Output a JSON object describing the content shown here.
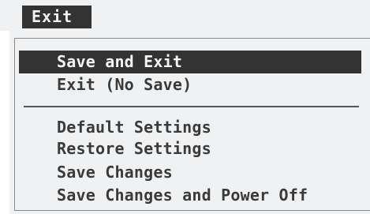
{
  "menu": {
    "title": "Exit"
  },
  "items": {
    "group1": [
      {
        "label": "Save and Exit",
        "selected": true
      },
      {
        "label": "Exit (No Save)",
        "selected": false
      }
    ],
    "group2": [
      {
        "label": "Default Settings"
      },
      {
        "label": "Restore Settings"
      },
      {
        "label": "Save Changes"
      },
      {
        "label": "Save Changes and Power Off"
      }
    ]
  },
  "colors": {
    "background": "#f0f1f2",
    "highlight": "#333333",
    "text": "#3a3a3a",
    "highlight_text": "#f5f5f5"
  }
}
